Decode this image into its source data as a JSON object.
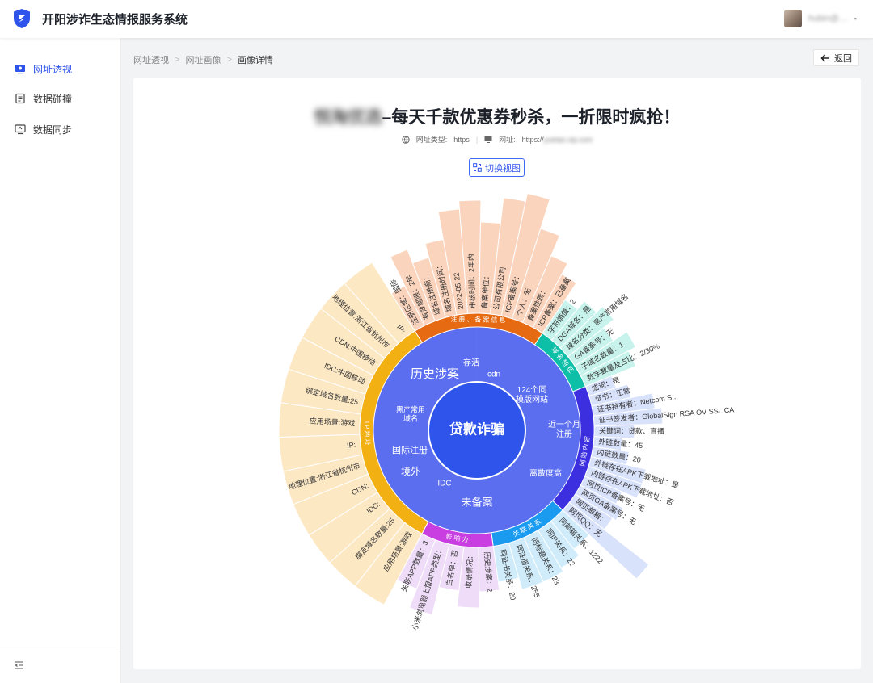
{
  "header": {
    "app_title": "开阳涉诈生态情报服务系统",
    "user_name": "hubin@…",
    "caret": "▪"
  },
  "sidebar": {
    "items": [
      {
        "label": "网址透视",
        "icon": "monitor-icon",
        "active": true
      },
      {
        "label": "数据碰撞",
        "icon": "document-icon",
        "active": false
      },
      {
        "label": "数据同步",
        "icon": "screen-sync-icon",
        "active": false
      }
    ],
    "collapse_icon": "menu-collapse-icon"
  },
  "breadcrumb": {
    "items": [
      "网址透视",
      "网址画像",
      "画像详情"
    ],
    "separator": ">"
  },
  "back_button": {
    "label": "返回",
    "icon": "arrow-left-icon"
  },
  "detail": {
    "title_blurred": "悦淘优选",
    "title_main": "–每天千款优惠券秒杀，一折限时疯抢！",
    "type_label": "网址类型:",
    "type_value": "https",
    "divider": "|",
    "url_label": "网址:",
    "url_value": "https://",
    "url_blurred": "yuetao.vip.com",
    "switch_label": "切换视图"
  },
  "colors": {
    "accent": "#2f54eb",
    "center": "#2f54eb",
    "middle": "#5b6ef0"
  },
  "sunburst": {
    "center": "贷款诈骗",
    "middle": [
      "历史涉案",
      "存活",
      "cdn",
      "124个同模版网站",
      "近一个月注册",
      "离散度高",
      "未备案",
      "IDC",
      "境外",
      "国际注册",
      "黑产常用域名"
    ],
    "categories": [
      {
        "name": "注册、备案信息",
        "color": "#e56a12",
        "light": "#fbd4bd",
        "leaves": [
          "注册区域：国际",
          "有效期限：2年",
          "域名注册商：",
          "域名注册时间：",
          "2022-05-22",
          "审核时间：2年内",
          "备案单位：",
          "公司有限公司",
          "ICP备案号：",
          "个人：无",
          "备案性质：",
          "ICP备案：已备案"
        ]
      },
      {
        "name": "域名特征",
        "color": "#0ebfa8",
        "light": "#c7f3ec",
        "leaves": [
          "字符熵值：2",
          "DGA域名：是",
          "域名分类：黑产常用域名",
          "GA备案号：无",
          "子域名数量：1",
          "数字数量及占比：2/30%"
        ]
      },
      {
        "name": "网站内容",
        "color": "#3b2fe0",
        "light": "#d9e2fb",
        "leaves": [
          "成词：是",
          "证书：正常",
          "证书持有者：Netcom S...",
          "证书签发者：GlobalSign RSA OV SSL CA",
          "关键词：贷款、直播",
          "外链数量：45",
          "内链数量：20",
          "外链存在APK下载地址：是",
          "内链存在APK下载地址：否",
          "网页ICP备案号：无",
          "网页GA备案号：无",
          "网页邮箱：",
          "网页QQ：无"
        ]
      },
      {
        "name": "关联关系",
        "color": "#1a9bf0",
        "light": "#d0ecfb",
        "leaves": [
          "同邮箱关系：1222",
          "同IP关系：22",
          "同标题关系：23",
          "同注册关系：255",
          "同证书关系：20"
        ]
      },
      {
        "name": "影响力",
        "color": "#c93ee0",
        "light": "#efdcf8",
        "leaves": [
          "历史涉案：2",
          "收录情况：",
          "白名单：否",
          "小米浏览器上报APP类型：",
          "关联APP数量：3"
        ]
      },
      {
        "name": "IP地址",
        "color": "#f3b012",
        "light": "#fde8c4",
        "leaves": [
          "应用场景:游戏",
          "绑定域名数量:25",
          "IDC:",
          "CDN:",
          "地理位置:浙江省杭州市",
          "IP:",
          "应用场景:游戏",
          "绑定域名数量:25",
          "IDC:中国移动",
          "CDN:中国移动",
          "地理位置:浙江省杭州市",
          "IP:"
        ]
      }
    ]
  }
}
